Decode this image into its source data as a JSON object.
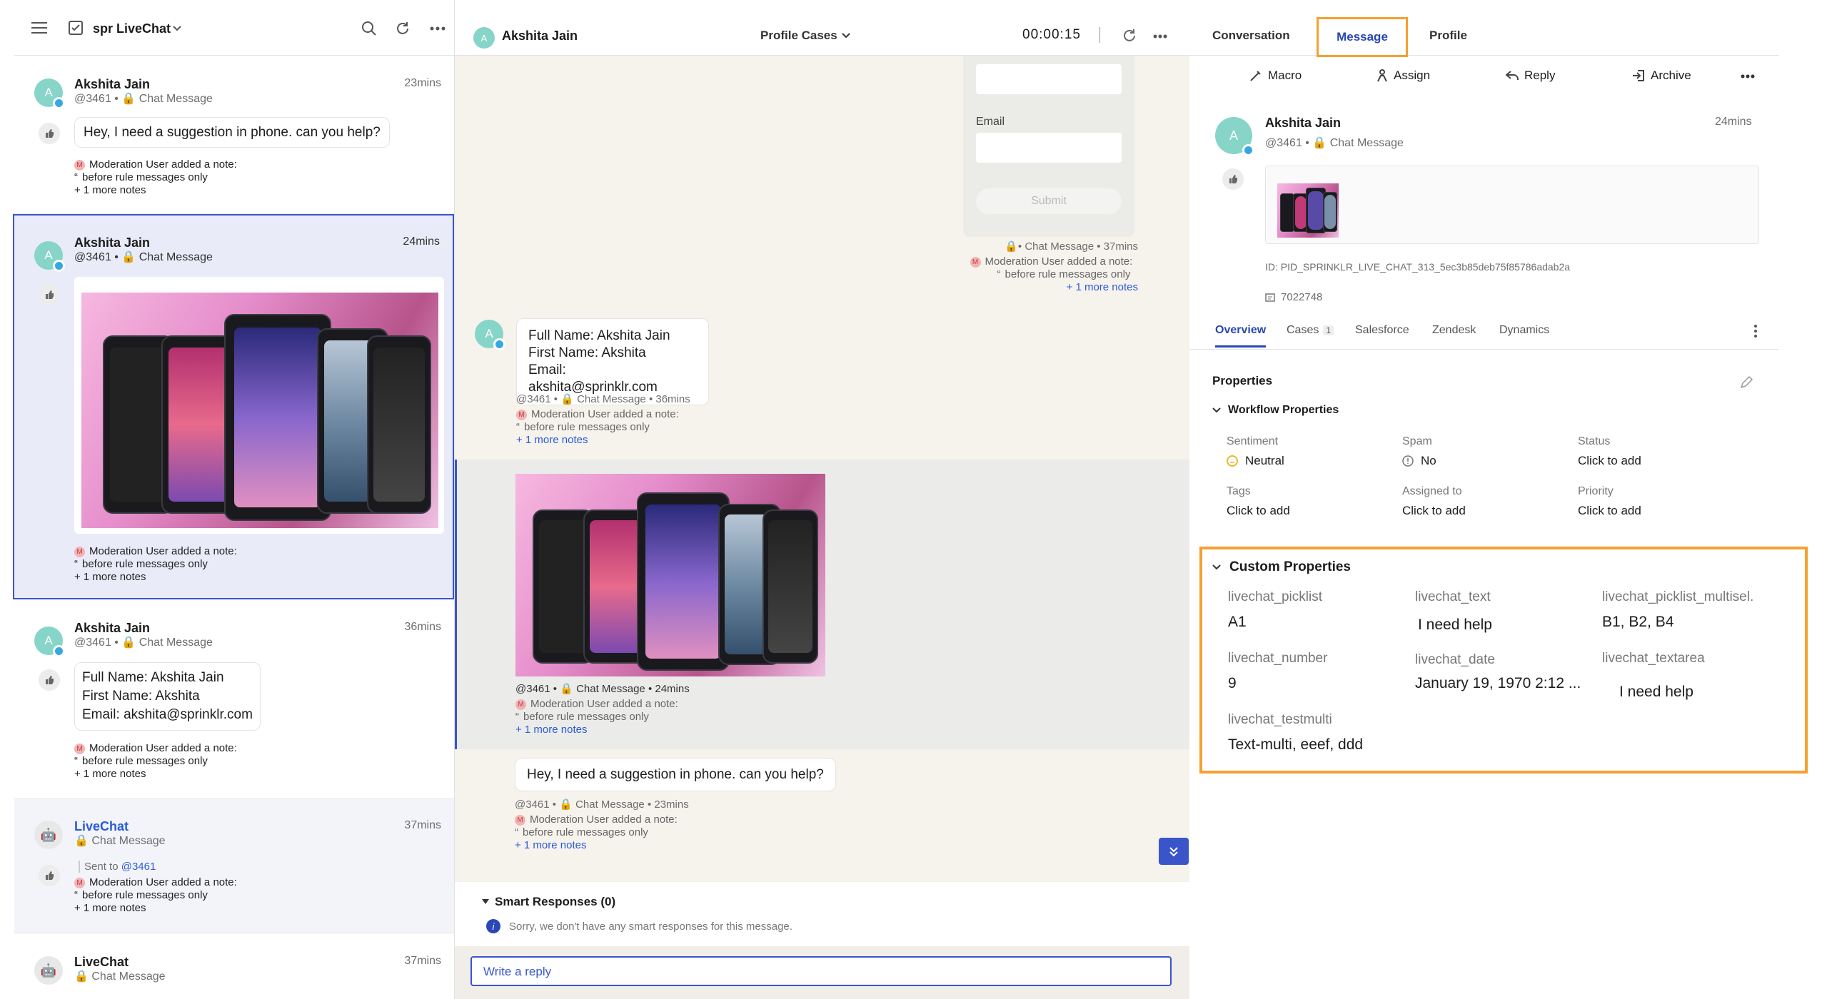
{
  "left": {
    "title": "spr LiveChat",
    "items": [
      {
        "name": "Akshita Jain",
        "handle": "@3461",
        "type": "Chat Message",
        "time": "23mins",
        "message": "Hey, I need a suggestion in phone. can you help?",
        "note_head": "Moderation User added a note:",
        "note_body": "before rule messages only",
        "more": "+ 1 more notes"
      },
      {
        "name": "Akshita Jain",
        "handle": "@3461",
        "type": "Chat Message",
        "time": "24mins",
        "note_head": "Moderation User added a note:",
        "note_body": "before rule messages only",
        "more": "+ 1 more notes"
      },
      {
        "name": "Akshita Jain",
        "handle": "@3461",
        "type": "Chat Message",
        "time": "36mins",
        "form_lines": [
          "Full Name: Akshita Jain",
          "First Name: Akshita",
          "Email: akshita@sprinklr.com"
        ],
        "note_head": "Moderation User added a note:",
        "note_body": "before rule messages only",
        "more": "+ 1 more notes"
      },
      {
        "name": "LiveChat",
        "type": "Chat Message",
        "time": "37mins",
        "sent_to_label": "Sent to",
        "sent_to": "@3461",
        "note_head": "Moderation User added a note:",
        "note_body": "before rule messages only",
        "more": "+ 1 more notes"
      },
      {
        "name": "LiveChat",
        "type": "Chat Message",
        "time": "37mins"
      }
    ]
  },
  "center": {
    "name": "Akshita Jain",
    "avatar_letter": "A",
    "dropdown": "Profile Cases",
    "timer": "00:00:15",
    "form": {
      "email_label": "Email",
      "submit": "Submit",
      "meta": "• Chat Message • 37mins",
      "note_head": "Moderation User added a note:",
      "note_body": "before rule messages only",
      "more": "+ 1 more notes"
    },
    "msg1": {
      "lines": [
        "Full Name: Akshita Jain",
        "First Name: Akshita",
        "Email: akshita@sprinklr.com"
      ],
      "meta_handle": "@3461",
      "meta": "Chat Message • 36mins",
      "note_head": "Moderation User added a note:",
      "note_body": "before rule messages only",
      "more": "+ 1 more notes"
    },
    "msg2": {
      "meta_handle": "@3461",
      "meta": "Chat Message • 24mins",
      "note_head": "Moderation User added a note:",
      "note_body": "before rule messages only",
      "more": "+ 1 more notes"
    },
    "msg3": {
      "text": "Hey, I need a suggestion in phone. can you help?",
      "meta_handle": "@3461",
      "meta": "Chat Message • 23mins",
      "note_head": "Moderation User added a note:",
      "note_body": "before rule messages only",
      "more": "+ 1 more notes"
    },
    "smart": {
      "title": "Smart Responses (0)",
      "empty": "Sorry, we don't have any smart responses for this message."
    },
    "reply_placeholder": "Write a reply"
  },
  "right": {
    "tabs": [
      "Conversation",
      "Message",
      "Profile"
    ],
    "actions": [
      "Macro",
      "Assign",
      "Reply",
      "Archive"
    ],
    "card": {
      "name": "Akshita Jain",
      "time": "24mins",
      "handle": "@3461",
      "type": "Chat Message",
      "id": "ID: PID_SPRINKLR_LIVE_CHAT_313_5ec3b85deb75f85786adab2a",
      "num": "7022748"
    },
    "subtabs": [
      {
        "label": "Overview"
      },
      {
        "label": "Cases",
        "count": "1"
      },
      {
        "label": "Salesforce"
      },
      {
        "label": "Zendesk"
      },
      {
        "label": "Dynamics"
      }
    ],
    "properties_title": "Properties",
    "workflow_title": "Workflow Properties",
    "workflow": [
      {
        "label": "Sentiment",
        "value": "Neutral"
      },
      {
        "label": "Spam",
        "value": "No"
      },
      {
        "label": "Status",
        "value": "Click to add"
      },
      {
        "label": "Tags",
        "value": "Click to add"
      },
      {
        "label": "Assigned to",
        "value": "Click to add"
      },
      {
        "label": "Priority",
        "value": "Click to add"
      }
    ],
    "custom_title": "Custom Properties",
    "custom": [
      {
        "label": "livechat_picklist",
        "value": "A1"
      },
      {
        "label": "livechat_text",
        "value": "I need help"
      },
      {
        "label": "livechat_picklist_multisel.",
        "value": "B1, B2, B4"
      },
      {
        "label": "livechat_number",
        "value": "9"
      },
      {
        "label": "livechat_date",
        "value": "January 19, 1970 2:12 ..."
      },
      {
        "label": "livechat_textarea",
        "value": "I need help"
      },
      {
        "label": "livechat_testmulti",
        "value": "Text-multi, eeef, ddd"
      }
    ],
    "highlight_color": "#f5a030"
  }
}
